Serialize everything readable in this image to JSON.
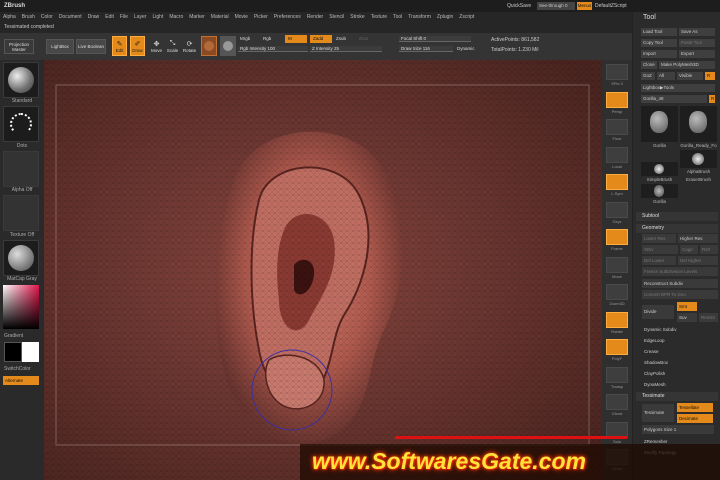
{
  "app": {
    "logo": "ZBrush"
  },
  "menu": [
    "Alpha",
    "Brush",
    "Color",
    "Document",
    "Draw",
    "Edit",
    "File",
    "Layer",
    "Light",
    "Macro",
    "Marker",
    "Material",
    "Movie",
    "Picker",
    "Preferences",
    "Render",
    "Stencil",
    "Stroke",
    "Texture",
    "Tool",
    "Transform",
    "Zplugin",
    "Zscript"
  ],
  "topright": {
    "quicksave": "QuickSave",
    "seethrough": "See-through 0",
    "menus": "Menus",
    "script": "DefaultZScript"
  },
  "status": "Tessimated completed",
  "toolbar": {
    "projection_master": "Projection Master",
    "lightbox": "LightBox",
    "live_boolean": "Live Boolean",
    "edit": "Edit",
    "draw": "Draw",
    "move": "Move",
    "scale": "Scale",
    "rotate": "Rotate",
    "mrgb": "Mrgb",
    "rgb": "Rgb",
    "m": "M",
    "zadd": "Zadd",
    "zsub": "Zsub",
    "zcut": "Zcut",
    "rgb_intensity": "Rgb Intensity 100",
    "z_intensity": "Z Intensity 25",
    "focal_shift": "Focal Shift 0",
    "draw_size": "Draw Size 116",
    "dynamic": "Dynamic",
    "active_points": "ActivePoints: 861,582",
    "total_points": "TotalPoints: 1.230 Mil"
  },
  "left": {
    "brush": "Standard",
    "stroke": "Dots",
    "alpha": "Alpha Off",
    "texture": "Texture Off",
    "material": "MatCap Gray",
    "gradient": "Gradient",
    "switch": "SwitchColor",
    "alternate": "Alternate"
  },
  "rightstrip": [
    "SPix 3",
    "Persp",
    "Floor",
    "Local",
    "L.Sym",
    "Gxyz",
    "Frame",
    "Move",
    "Zoom3D",
    "Rotate",
    "PolyF",
    "Transp",
    "Ghost",
    "Solo",
    "Xpose"
  ],
  "tool": {
    "title": "Tool",
    "load": "Load Tool",
    "save_as": "Save As",
    "copy": "Copy Tool",
    "paste": "Paste Tool",
    "import": "Import",
    "export": "Export",
    "clone": "Clone",
    "make_polymesh": "Make PolyMesh3D",
    "goz": "GoZ",
    "all": "All",
    "visible": "Visible",
    "r": "R",
    "lightbox_tools": "Lightbox▶Tools",
    "gorilla_slider": "Gorilla_48",
    "thumbs": [
      "Gorilla",
      "Gorilla_Ready_Fo",
      "AlphaBrush",
      "SimpleBrush",
      "EraserBrush",
      "Gorilla"
    ],
    "subtool": "Subtool",
    "geometry": "Geometry",
    "lower_res": "Lower Res",
    "higher_res": "Higher Res",
    "sdiv": "SDiv",
    "cage": "Cage",
    "rstr": "Rstr",
    "del_lower": "Del Lower",
    "del_higher": "Del Higher",
    "freeze": "Freeze SubDivision Levels",
    "reconstruct": "Reconstruct Subdiv",
    "convert_bpr": "Convert BPR To Geo",
    "divide": "Divide",
    "smt": "Smt",
    "suv": "Suv",
    "rsmt": "ReSmt",
    "dynamic_subdiv": "Dynamic Subdiv",
    "edgeloop": "EdgeLoop",
    "crease": "Crease",
    "shadowbox": "ShadowBox",
    "claypolish": "ClayPolish",
    "dynamesh": "DynaMesh",
    "tessimate": "Tessimate",
    "tessimate_btn": "Tessimate",
    "tessellate": "Tessellate",
    "decimate": "Decimate",
    "polygons_size": "Polygons Size 1",
    "zremesher": "ZRemesher",
    "modify_topology": "Modify Topology"
  },
  "watermark": "www.SoftwaresGate.com",
  "colors": {
    "accent": "#e48a1a",
    "canvas": "#5a2e2a",
    "watermark": "#ffe23a"
  }
}
